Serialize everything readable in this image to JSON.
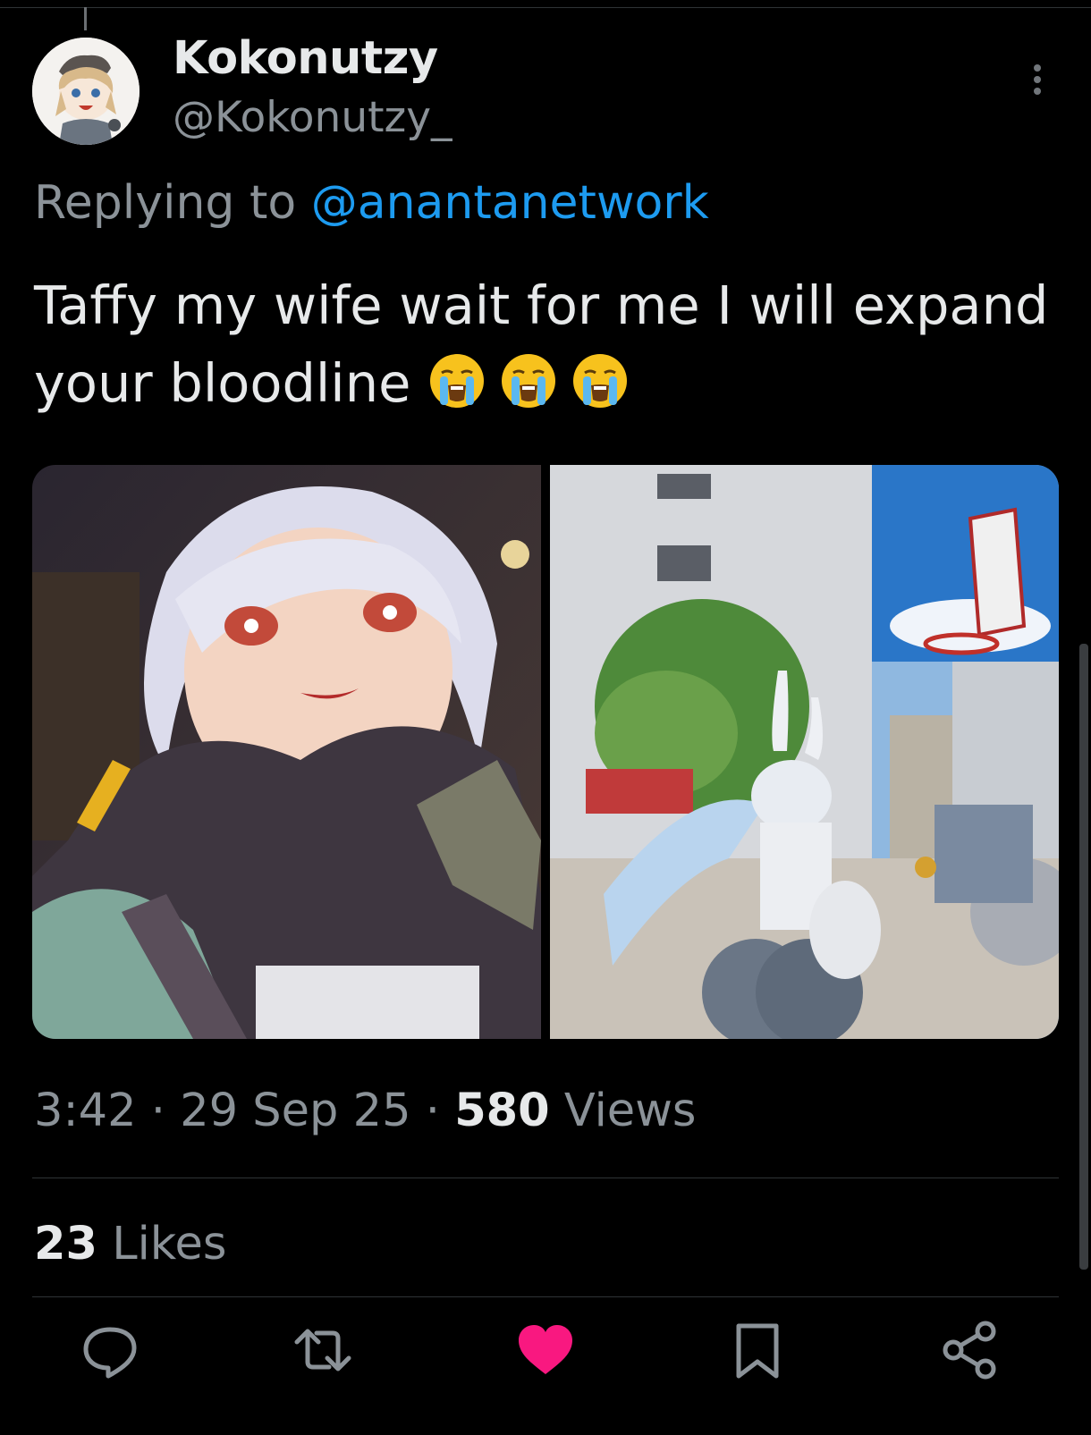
{
  "post": {
    "display_name": "Kokonutzy",
    "handle": "@Kokonutzy_",
    "reply_prefix": "Replying to",
    "reply_to": "@anantanetwork",
    "text": "Taffy my wife wait for me I will expand your bloodline",
    "emojis": [
      "loudly-crying-face-emoji",
      "loudly-crying-face-emoji",
      "loudly-crying-face-emoji"
    ],
    "time": "3:42",
    "separator": "·",
    "date": "29 Sep 25",
    "views_count": "580",
    "views_label": "Views",
    "likes_count": "23",
    "likes_label": "Likes",
    "liked": true
  },
  "media": [
    {
      "icon": "anime-girl-closeup-image"
    },
    {
      "icon": "bunny-girl-street-image"
    }
  ],
  "actions": [
    {
      "icon": "reply-icon"
    },
    {
      "icon": "retweet-icon"
    },
    {
      "icon": "like-icon",
      "color": "#f91880"
    },
    {
      "icon": "bookmark-icon"
    },
    {
      "icon": "share-icon"
    }
  ],
  "colors": {
    "background": "#000000",
    "text": "#e7e9ea",
    "secondary": "#8b9298",
    "link": "#1d9bf0",
    "like": "#f91880"
  }
}
